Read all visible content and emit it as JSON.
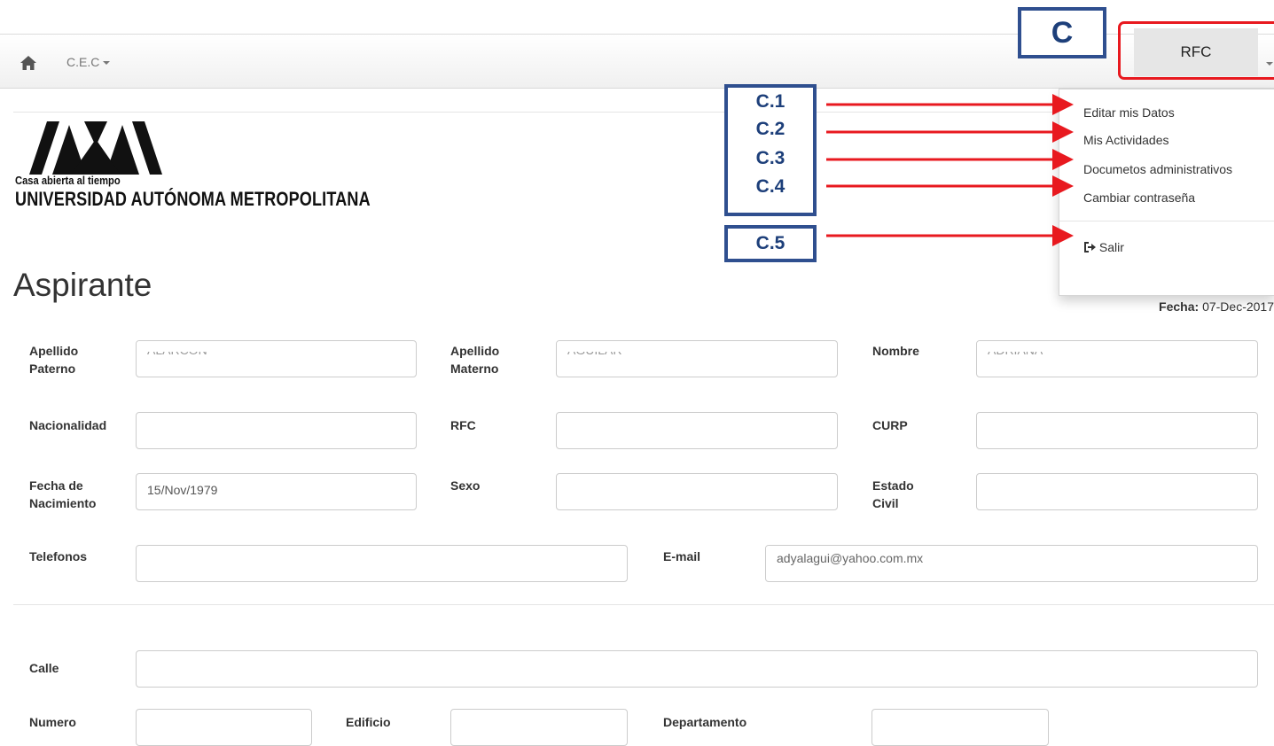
{
  "navbar": {
    "home_icon": "home-icon",
    "brand_label": "C.E.C"
  },
  "logo": {
    "tagline": "Casa abierta al tiempo",
    "university": "UNIVERSIDAD AUTÓNOMA METROPOLITANA"
  },
  "page": {
    "title": "Aspirante",
    "fecha_label": "Fecha:",
    "fecha_value": "07-Dec-2017"
  },
  "form": {
    "apellido_paterno": {
      "label_line1": "Apellido",
      "label_line2": "Paterno",
      "value": "ALARCON"
    },
    "apellido_materno": {
      "label_line1": "Apellido",
      "label_line2": "Materno",
      "value": "AGUILAR"
    },
    "nombre": {
      "label": "Nombre",
      "value": "ADRIANA"
    },
    "nacionalidad": {
      "label": "Nacionalidad",
      "value": ""
    },
    "rfc": {
      "label": "RFC",
      "value": ""
    },
    "curp": {
      "label": "CURP",
      "value": ""
    },
    "fecha_nacimiento": {
      "label_line1": "Fecha de",
      "label_line2": "Nacimiento",
      "value": "15/Nov/1979"
    },
    "sexo": {
      "label": "Sexo",
      "value": ""
    },
    "estado_civil": {
      "label_line1": "Estado",
      "label_line2": "Civil",
      "value": ""
    },
    "telefonos": {
      "label": "Telefonos",
      "value": ""
    },
    "email": {
      "label": "E-mail",
      "value": "adyalagui@yahoo.com.mx"
    },
    "calle": {
      "label": "Calle",
      "value": ""
    },
    "numero": {
      "label": "Numero",
      "value": ""
    },
    "edificio": {
      "label": "Edificio",
      "value": ""
    },
    "departamento": {
      "label": "Departamento",
      "value": ""
    }
  },
  "user_menu": {
    "button_label": "RFC",
    "items": [
      {
        "label": "Editar mis Datos"
      },
      {
        "label": "Mis Actividades"
      },
      {
        "label": "Documetos administrativos"
      },
      {
        "label": "Cambiar contraseña"
      }
    ],
    "logout_label": "Salir",
    "logout_icon": "sign-out-icon"
  },
  "annotations": {
    "c": "C",
    "c1": "C.1",
    "c2": "C.2",
    "c3": "C.3",
    "c4": "C.4",
    "c5": "C.5",
    "box_color": "#2f4f8f",
    "arrow_color": "#e8191f"
  }
}
